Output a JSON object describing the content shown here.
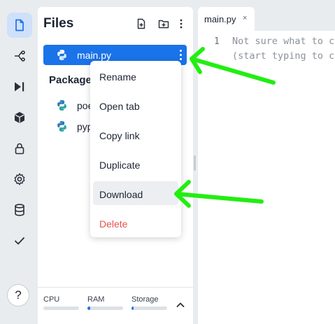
{
  "colors": {
    "accent": "#1a73e8",
    "danger": "#e5534b",
    "annotation_arrow": "#22ee11",
    "python_blue": "#2b7bb9",
    "python_teal": "#2ea3a3"
  },
  "rail": {
    "items": [
      {
        "name": "files",
        "icon": "file-icon",
        "active": true
      },
      {
        "name": "git",
        "icon": "git-branch-icon",
        "active": false
      },
      {
        "name": "run",
        "icon": "play-step-icon",
        "active": false
      },
      {
        "name": "packages",
        "icon": "cube-icon",
        "active": false
      },
      {
        "name": "secrets",
        "icon": "lock-icon",
        "active": false
      },
      {
        "name": "settings",
        "icon": "gear-icon",
        "active": false
      },
      {
        "name": "database",
        "icon": "database-icon",
        "active": false
      },
      {
        "name": "tests",
        "icon": "check-icon",
        "active": false
      }
    ],
    "help_label": "?"
  },
  "files_panel": {
    "title": "Files",
    "header_icons": [
      "new-file-icon",
      "new-folder-icon",
      "kebab-menu-icon"
    ],
    "files": [
      {
        "name": "main.py",
        "icon": "python-icon",
        "selected": true
      }
    ],
    "packages_title": "Package",
    "packages": [
      {
        "name": "poe",
        "icon": "python-icon"
      },
      {
        "name": "pyp",
        "icon": "python-icon"
      }
    ]
  },
  "resources": {
    "cpu_label": "CPU",
    "ram_label": "RAM",
    "storage_label": "Storage",
    "cpu_fraction": 0.0,
    "ram_fraction": 0.08,
    "storage_fraction": 0.05
  },
  "context_menu": {
    "items": [
      {
        "label": "Rename",
        "danger": false,
        "hover": false
      },
      {
        "label": "Open tab",
        "danger": false,
        "hover": false
      },
      {
        "label": "Copy link",
        "danger": false,
        "hover": false
      },
      {
        "label": "Duplicate",
        "danger": false,
        "hover": false
      },
      {
        "label": "Download",
        "danger": false,
        "hover": true
      },
      {
        "label": "Delete",
        "danger": true,
        "hover": false
      }
    ]
  },
  "editor": {
    "tab_label": "main.py",
    "tab_close": "×",
    "line_number": "1",
    "code_lines": [
      "Not sure what to c",
      "(start typing to c"
    ]
  }
}
